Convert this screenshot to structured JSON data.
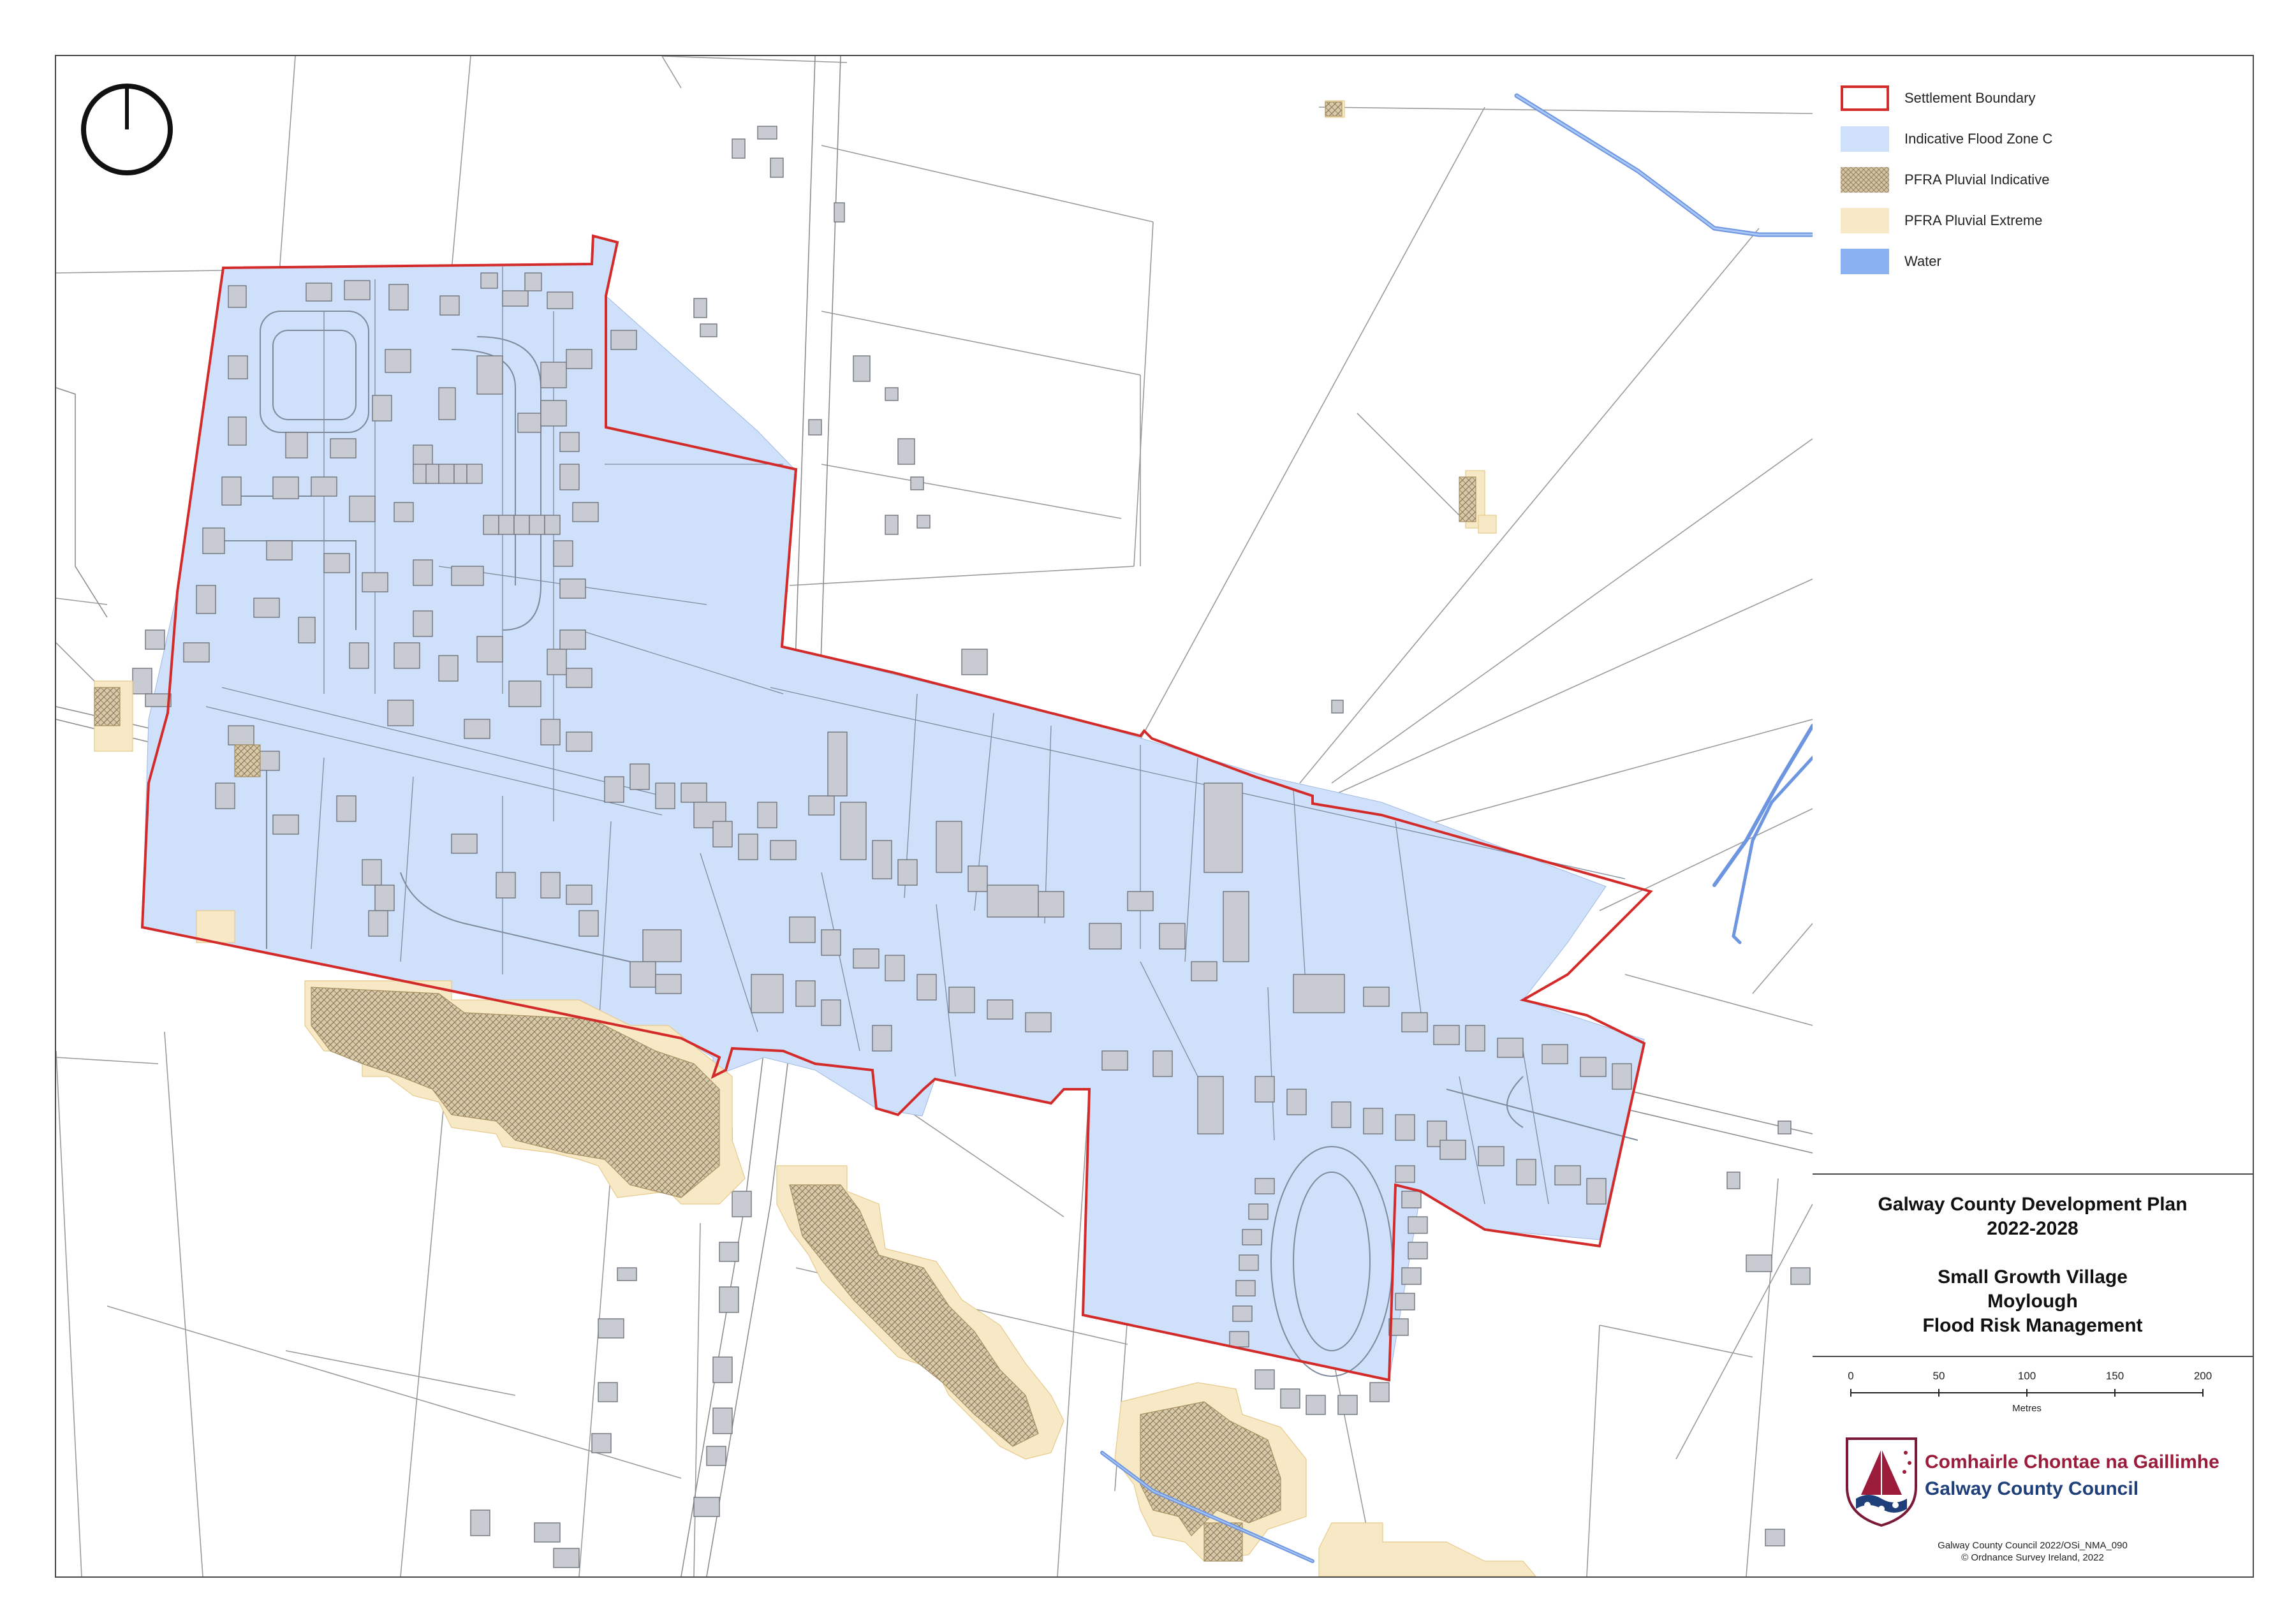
{
  "legend": {
    "items": [
      {
        "label": "Settlement Boundary",
        "swatch": "boundary",
        "stroke": "#d32a2a",
        "fill": "#ffffff"
      },
      {
        "label": "Indicative Flood Zone C",
        "swatch": "flood",
        "fill": "#cfe0fb"
      },
      {
        "label": "PFRA Pluvial Indicative",
        "swatch": "hatch",
        "fill": "#c9b89a"
      },
      {
        "label": "PFRA Pluvial Extreme",
        "swatch": "extreme",
        "fill": "#f7e9c6"
      },
      {
        "label": "Water",
        "swatch": "water",
        "fill": "#8ab2f2"
      }
    ]
  },
  "title": {
    "plan": "Galway County Development Plan",
    "years": "2022-2028",
    "category": "Small Growth Village",
    "village": "Moylough",
    "subject": "Flood Risk Management"
  },
  "scale_bar": {
    "ticks": [
      "0",
      "50",
      "100",
      "150",
      "200"
    ],
    "unit": "Metres"
  },
  "council": {
    "name_irish": "Comhairle Chontae na Gaillimhe",
    "name_english": "Galway County Council"
  },
  "credits": {
    "licence": "Galway County Council 2022/OSi_NMA_090",
    "copyright": "© Ordnance Survey Ireland, 2022"
  },
  "colors": {
    "boundary": "#d32a2a",
    "flood_zone_c": "#cfe0fb",
    "pluvial_indicative": "#c9b89a",
    "pluvial_extreme": "#f7e9c6",
    "water": "#8ab2f2",
    "buildings": "#c8ccd2"
  },
  "icons": {
    "north_arrow": "north-arrow-icon",
    "council_crest": "council-crest-icon"
  }
}
